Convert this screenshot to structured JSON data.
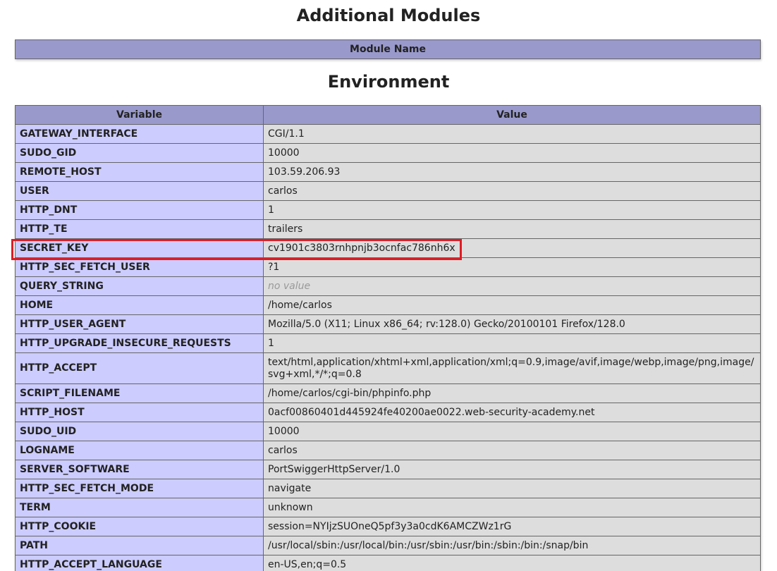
{
  "headings": {
    "modules": "Additional Modules",
    "environment": "Environment"
  },
  "modules_table": {
    "header": "Module Name"
  },
  "env_table": {
    "headers": [
      "Variable",
      "Value"
    ],
    "rows": [
      {
        "name": "GATEWAY_INTERFACE",
        "value": "CGI/1.1"
      },
      {
        "name": "SUDO_GID",
        "value": "10000"
      },
      {
        "name": "REMOTE_HOST",
        "value": "103.59.206.93"
      },
      {
        "name": "USER",
        "value": "carlos"
      },
      {
        "name": "HTTP_DNT",
        "value": "1"
      },
      {
        "name": "HTTP_TE",
        "value": "trailers"
      },
      {
        "name": "SECRET_KEY",
        "value": "cv1901c3803rnhpnjb3ocnfac786nh6x",
        "highlighted": true
      },
      {
        "name": "HTTP_SEC_FETCH_USER",
        "value": "?1"
      },
      {
        "name": "QUERY_STRING",
        "value": "no value",
        "novalue": true
      },
      {
        "name": "HOME",
        "value": "/home/carlos"
      },
      {
        "name": "HTTP_USER_AGENT",
        "value": "Mozilla/5.0 (X11; Linux x86_64; rv:128.0) Gecko/20100101 Firefox/128.0"
      },
      {
        "name": "HTTP_UPGRADE_INSECURE_REQUESTS",
        "value": "1"
      },
      {
        "name": "HTTP_ACCEPT",
        "value": "text/html,application/xhtml+xml,application/xml;q=0.9,image/avif,image/webp,image/png,image/svg+xml,*/*;q=0.8",
        "tall": true
      },
      {
        "name": "SCRIPT_FILENAME",
        "value": "/home/carlos/cgi-bin/phpinfo.php"
      },
      {
        "name": "HTTP_HOST",
        "value": "0acf00860401d445924fe40200ae0022.web-security-academy.net"
      },
      {
        "name": "SUDO_UID",
        "value": "10000"
      },
      {
        "name": "LOGNAME",
        "value": "carlos"
      },
      {
        "name": "SERVER_SOFTWARE",
        "value": "PortSwiggerHttpServer/1.0"
      },
      {
        "name": "HTTP_SEC_FETCH_MODE",
        "value": "navigate"
      },
      {
        "name": "TERM",
        "value": "unknown"
      },
      {
        "name": "HTTP_COOKIE",
        "value": "session=NYIjzSUOneQ5pf3y3a0cdK6AMCZWz1rG"
      },
      {
        "name": "PATH",
        "value": "/usr/local/sbin:/usr/local/bin:/usr/sbin:/usr/bin:/sbin:/bin:/snap/bin"
      },
      {
        "name": "HTTP_ACCEPT_LANGUAGE",
        "value": "en-US,en;q=0.5"
      }
    ]
  },
  "colors": {
    "header_bg": "#9999cc",
    "name_cell_bg": "#ccccff",
    "value_cell_bg": "#dddddd",
    "highlight_border": "#e01b24",
    "novalue_text": "#999999"
  }
}
